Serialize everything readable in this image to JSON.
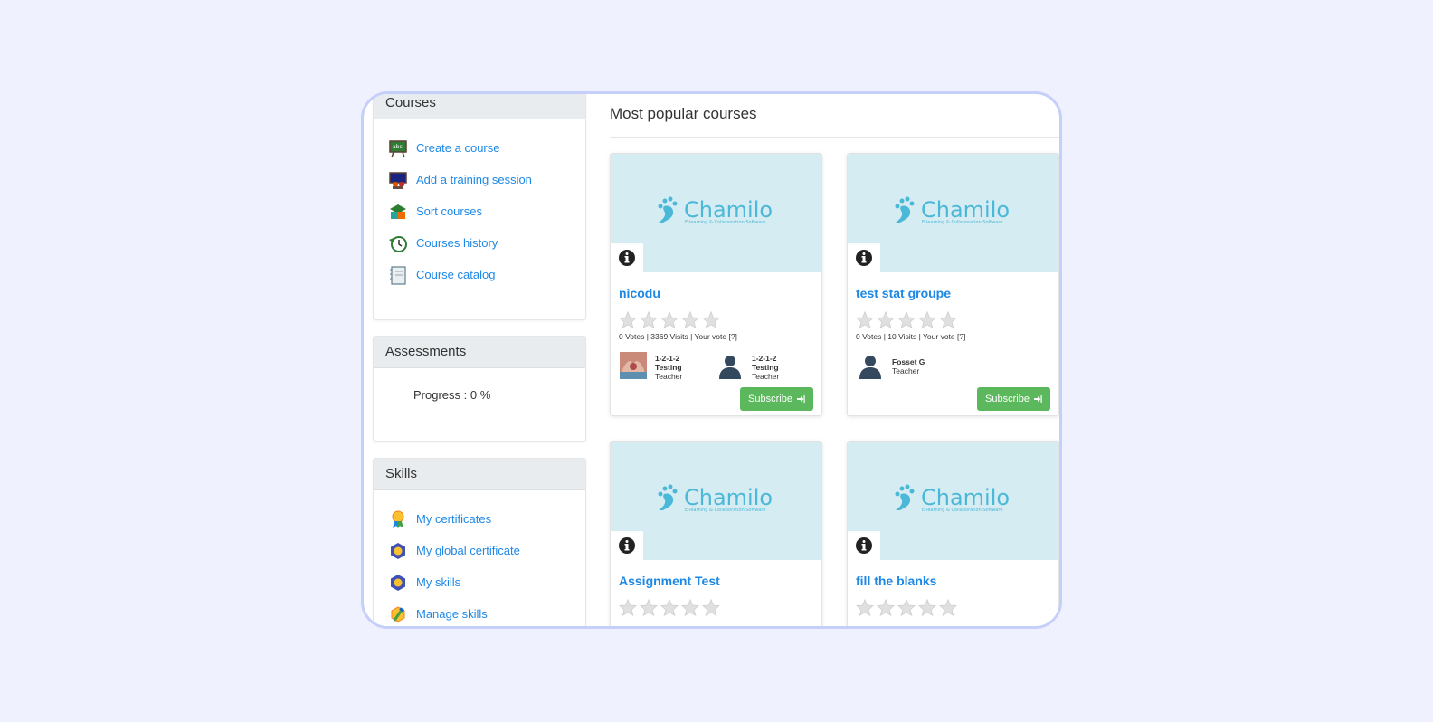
{
  "sidebar": {
    "courses": {
      "title": "Courses",
      "items": [
        {
          "label": "Create a course",
          "icon": "create-course-icon"
        },
        {
          "label": "Add a training session",
          "icon": "training-session-icon"
        },
        {
          "label": "Sort courses",
          "icon": "sort-courses-icon"
        },
        {
          "label": "Courses history",
          "icon": "history-icon"
        },
        {
          "label": "Course catalog",
          "icon": "catalog-icon"
        }
      ]
    },
    "assessments": {
      "title": "Assessments",
      "progress": "Progress : 0 %"
    },
    "skills": {
      "title": "Skills",
      "items": [
        {
          "label": "My certificates",
          "icon": "certificate-icon"
        },
        {
          "label": "My global certificate",
          "icon": "global-certificate-icon"
        },
        {
          "label": "My skills",
          "icon": "skills-icon"
        },
        {
          "label": "Manage skills",
          "icon": "manage-skills-icon"
        }
      ]
    }
  },
  "main": {
    "title": "Most popular courses",
    "logo_text": "Chamilo",
    "logo_tagline": "E-learning & Collaboration Software",
    "subscribe_label": "Subscribe",
    "cards": [
      {
        "title": "nicodu",
        "stats": "0 Votes | 3369 Visits | Your vote [?]",
        "teachers": [
          {
            "name": "1-2-1-2 Testing",
            "role": "Teacher"
          },
          {
            "name": "1-2-1-2 Testing",
            "role": "Teacher"
          }
        ]
      },
      {
        "title": "test stat groupe",
        "stats": "0 Votes | 10 Visits | Your vote [?]",
        "teachers": [
          {
            "name": "Fosset G",
            "role": "Teacher"
          }
        ]
      },
      {
        "title": "Assignment Test"
      },
      {
        "title": "fill the blanks"
      }
    ]
  },
  "colors": {
    "link": "#1e88e5",
    "subscribe": "#5cb85c",
    "card_image_bg": "#d4ecf2",
    "chamilo_blue": "#4cb8d8"
  }
}
